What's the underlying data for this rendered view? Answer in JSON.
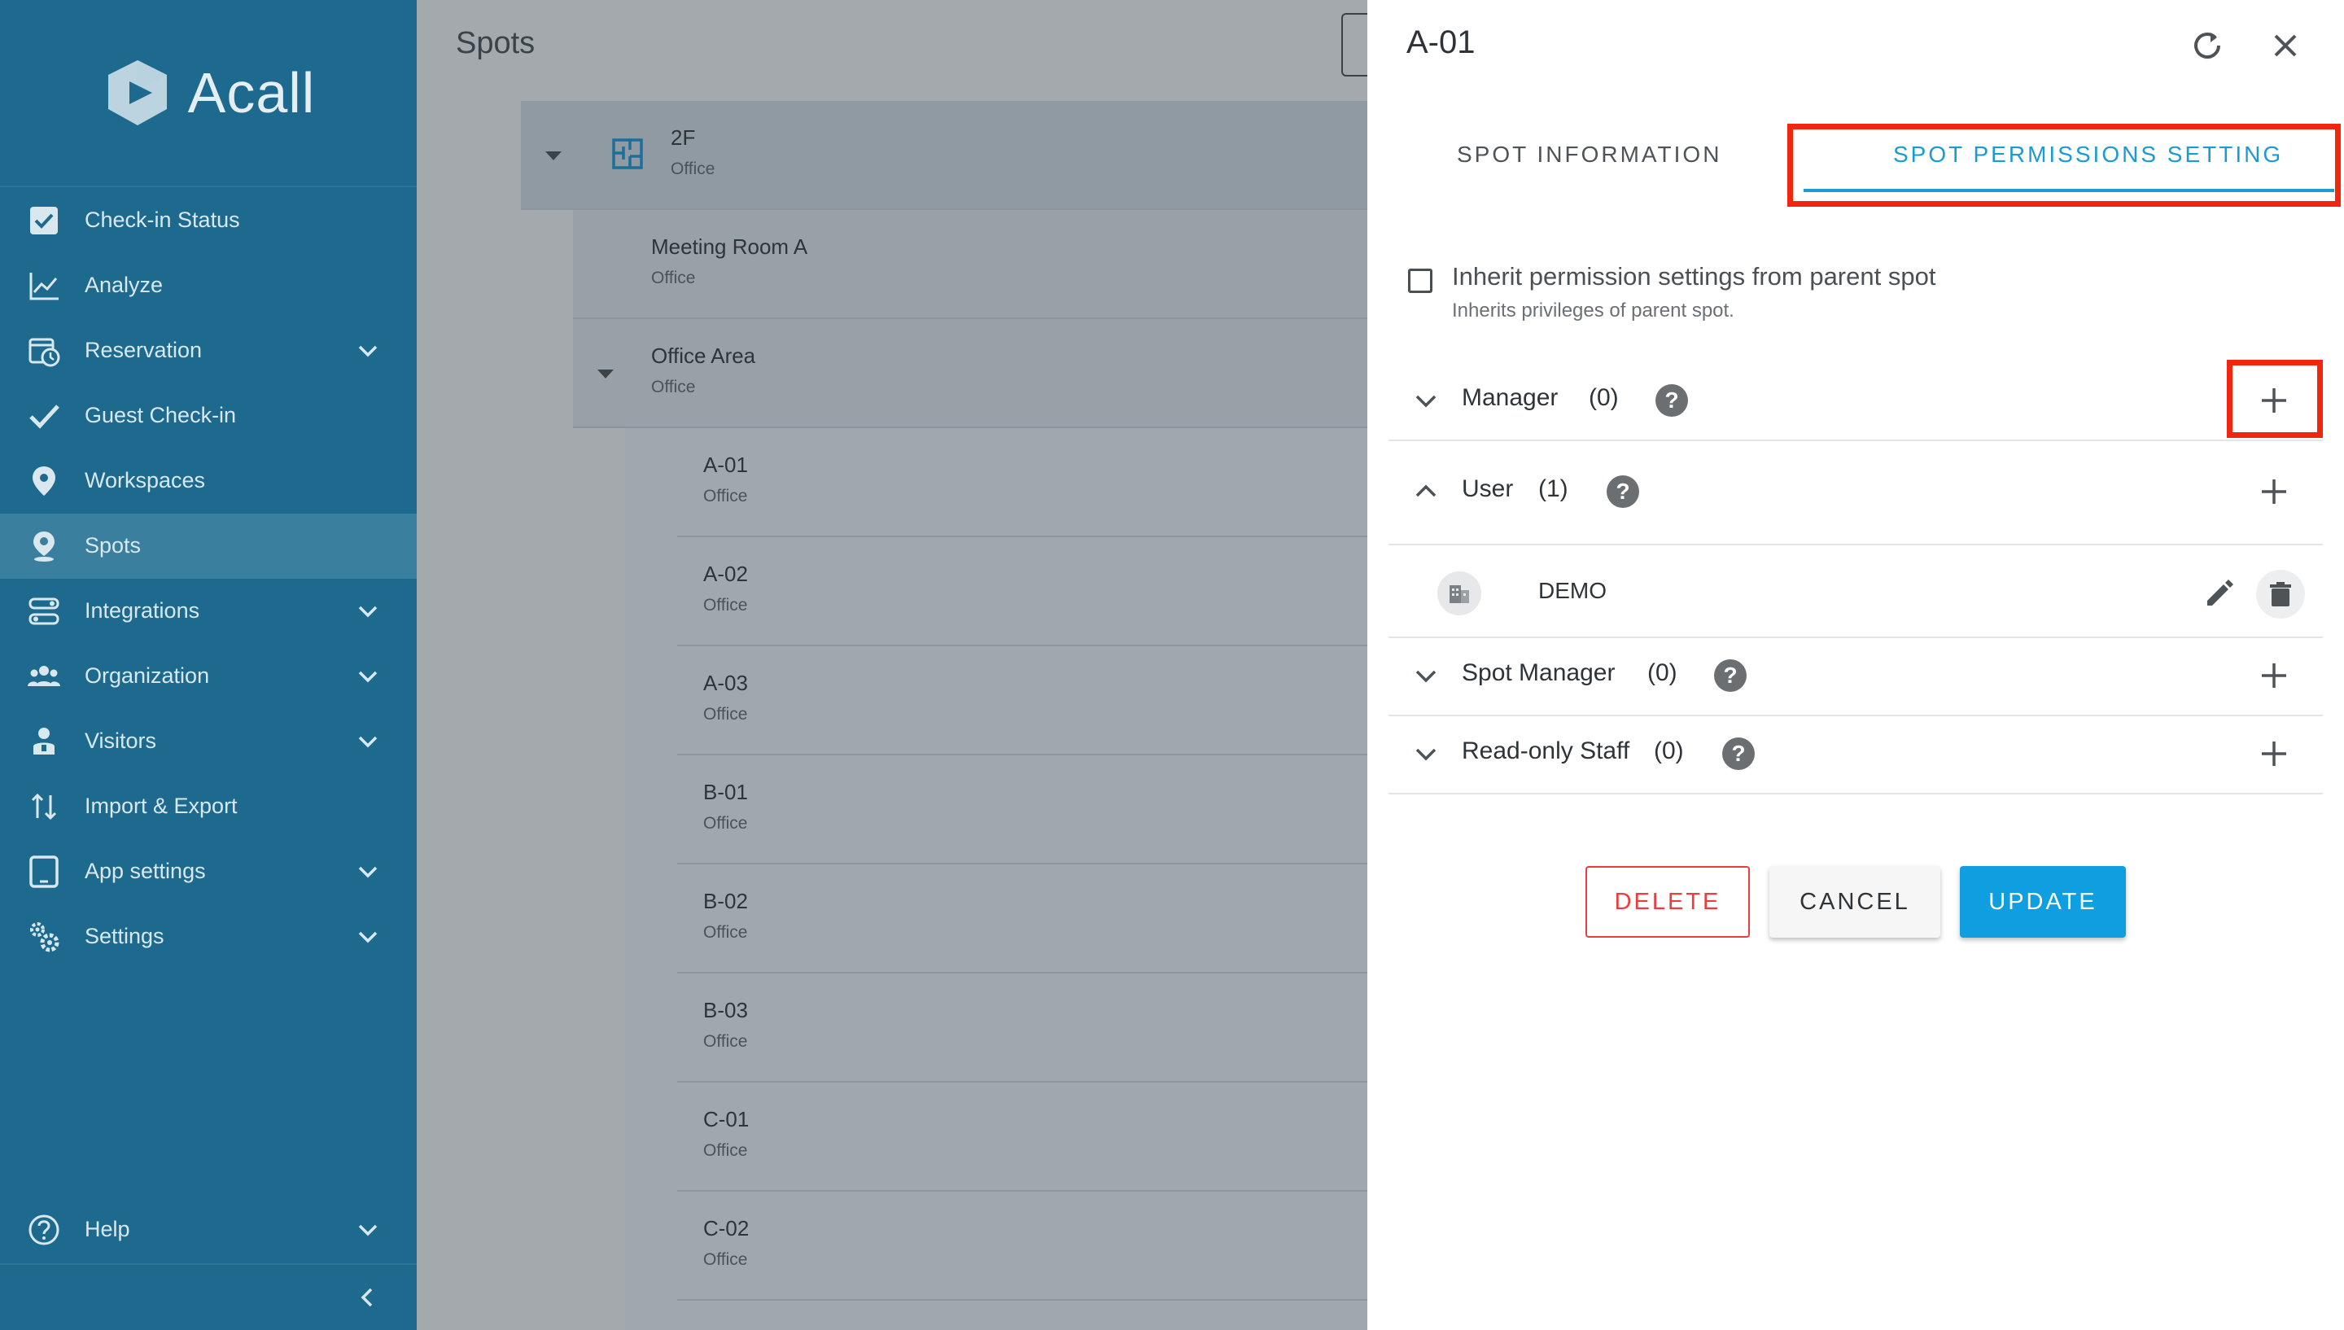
{
  "app": {
    "brand": "Acall"
  },
  "sidebar": {
    "items": [
      {
        "label": "Check-in Status",
        "icon": "checkbox-icon",
        "has_chevron": false
      },
      {
        "label": "Analyze",
        "icon": "line-chart-icon",
        "has_chevron": false
      },
      {
        "label": "Reservation",
        "icon": "calendar-clock-icon",
        "has_chevron": true
      },
      {
        "label": "Guest Check-in",
        "icon": "checkmark-icon",
        "has_chevron": false
      },
      {
        "label": "Workspaces",
        "icon": "map-pin-icon",
        "has_chevron": false
      },
      {
        "label": "Spots",
        "icon": "person-pin-icon",
        "has_chevron": false,
        "active": true
      },
      {
        "label": "Integrations",
        "icon": "integrations-icon",
        "has_chevron": true
      },
      {
        "label": "Organization",
        "icon": "people-group-icon",
        "has_chevron": true
      },
      {
        "label": "Visitors",
        "icon": "visitor-icon",
        "has_chevron": true
      },
      {
        "label": "Import & Export",
        "icon": "import-export-icon",
        "has_chevron": false
      },
      {
        "label": "App settings",
        "icon": "tablet-icon",
        "has_chevron": true
      },
      {
        "label": "Settings",
        "icon": "gears-icon",
        "has_chevron": true
      }
    ],
    "help_label": "Help"
  },
  "spots_page": {
    "title": "Spots",
    "tree": [
      {
        "name": "2F",
        "type": "Office",
        "level": 0
      },
      {
        "name": "Meeting Room A",
        "type": "Office",
        "level": 1
      },
      {
        "name": "Office Area",
        "type": "Office",
        "level": 1
      },
      {
        "name": "A-01",
        "type": "Office",
        "level": 2
      },
      {
        "name": "A-02",
        "type": "Office",
        "level": 2
      },
      {
        "name": "A-03",
        "type": "Office",
        "level": 2
      },
      {
        "name": "B-01",
        "type": "Office",
        "level": 2
      },
      {
        "name": "B-02",
        "type": "Office",
        "level": 2
      },
      {
        "name": "B-03",
        "type": "Office",
        "level": 2
      },
      {
        "name": "C-01",
        "type": "Office",
        "level": 2
      },
      {
        "name": "C-02",
        "type": "Office",
        "level": 2
      }
    ]
  },
  "panel": {
    "title": "A-01",
    "tabs": {
      "info": "SPOT INFORMATION",
      "permissions": "SPOT PERMISSIONS SETTING"
    },
    "inherit": {
      "label": "Inherit permission settings from parent spot",
      "sub": "Inherits privileges of parent spot.",
      "checked": false
    },
    "sections": [
      {
        "name": "Manager",
        "count": "(0)",
        "expanded": false
      },
      {
        "name": "User",
        "count": "(1)",
        "expanded": true,
        "entries": [
          {
            "name": "DEMO",
            "icon": "building-icon"
          }
        ]
      },
      {
        "name": "Spot Manager",
        "count": "(0)",
        "expanded": false
      },
      {
        "name": "Read-only Staff",
        "count": "(0)",
        "expanded": false
      }
    ],
    "help_glyph": "?",
    "buttons": {
      "delete": "DELETE",
      "cancel": "CANCEL",
      "update": "UPDATE"
    }
  },
  "colors": {
    "sidebar": "#1d6a8e",
    "accent": "#1a9ad6",
    "highlight": "#f0260f",
    "danger": "#ea3e3e",
    "primary_button": "#0f9ee0"
  }
}
